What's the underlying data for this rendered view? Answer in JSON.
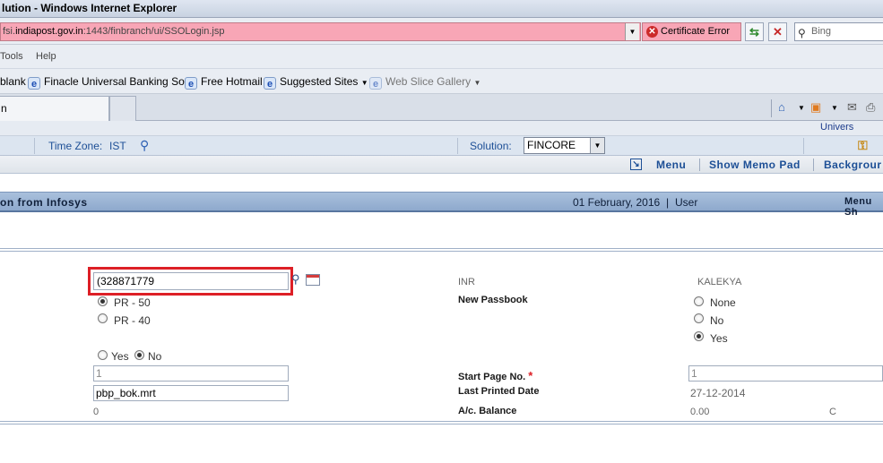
{
  "window": {
    "title": "lution - Windows Internet Explorer"
  },
  "address": {
    "prefix": "fsi.",
    "host": "indiapost.gov.in",
    "path": ":1443/finbranch/ui/SSOLogin.jsp",
    "cert_error": "Certificate Error",
    "search_placeholder": "Bing"
  },
  "menu": {
    "tools": "Tools",
    "help": "Help"
  },
  "favorites": {
    "blank": "blank",
    "finacle": "Finacle Universal Banking So...",
    "hotmail": "Free Hotmail",
    "suggested": "Suggested Sites",
    "webslice": "Web Slice Gallery"
  },
  "tab": {
    "title": "n"
  },
  "app": {
    "univers": "Univers",
    "timezone_label": "Time Zone:",
    "timezone_value": "IST",
    "solution_label": "Solution:",
    "solution_value": "FINCORE",
    "links": {
      "menu": "Menu",
      "memo": "Show Memo Pad",
      "background": "Backgrour"
    },
    "banner_title": "on from Infosys",
    "banner_date": "01 February, 2016",
    "banner_sep": "|",
    "banner_user": "User",
    "banner_menu": "Menu Sh"
  },
  "form": {
    "account_value": "(328871779",
    "pr50": "PR - 50",
    "pr40": "PR - 40",
    "yes_label": "Yes",
    "no_label": "No",
    "field_one": "1",
    "report_file": "pbp_bok.mrt",
    "zero": "0",
    "currency": "INR",
    "new_passbook_label": "New Passbook",
    "customer_name": "KALEKYA",
    "np_none": "None",
    "np_no": "No",
    "np_yes": "Yes",
    "start_page_label": "Start Page No.",
    "required_mark": "*",
    "start_page_value": "1",
    "last_printed_label": "Last Printed Date",
    "last_printed_value": "27-12-2014",
    "balance_label": "A/c. Balance",
    "balance_value": "0.00",
    "balance_type": "C"
  }
}
